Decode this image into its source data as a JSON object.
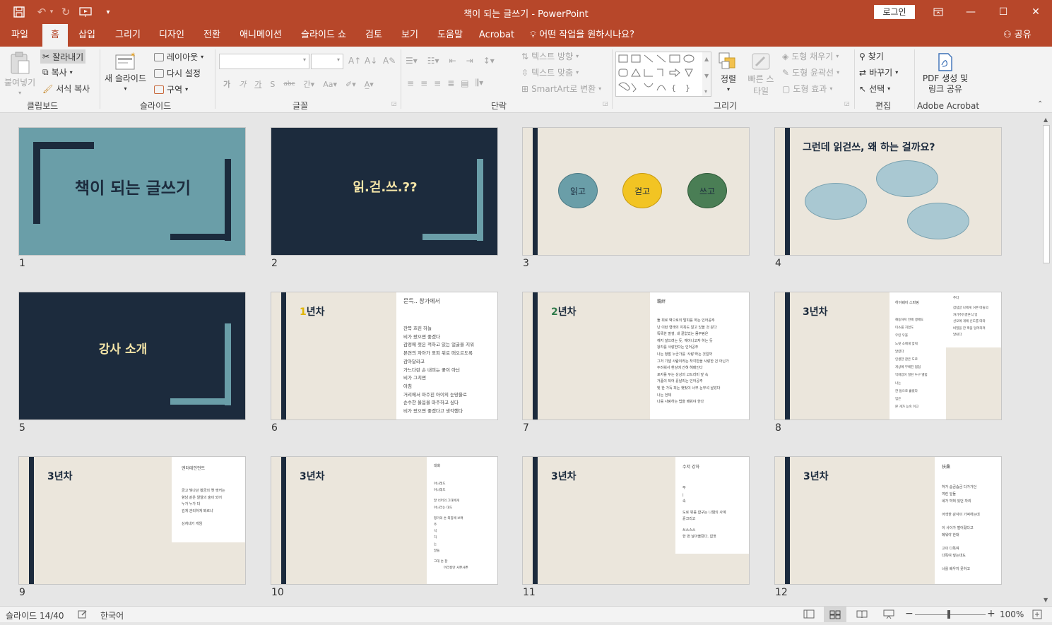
{
  "window": {
    "title": "책이 되는 글쓰기  -  PowerPoint",
    "login_label": "로그인",
    "share_label": "공유"
  },
  "tabs": [
    "파일",
    "홈",
    "삽입",
    "그리기",
    "디자인",
    "전환",
    "애니메이션",
    "슬라이드 쇼",
    "검토",
    "보기",
    "도움말",
    "Acrobat",
    "어떤 작업을 원하시나요?"
  ],
  "ribbon": {
    "clipboard": {
      "paste": "붙여넣기",
      "cut": "잘라내기",
      "copy": "복사",
      "format_painter": "서식 복사",
      "label": "클립보드"
    },
    "slides": {
      "new_slide": "새 슬라이드",
      "layout": "레이아웃",
      "reset": "다시 설정",
      "section": "구역",
      "label": "슬라이드"
    },
    "font": {
      "label": "글꼴",
      "small_a": "가",
      "case": "Aa",
      "spacing": "간"
    },
    "paragraph": {
      "text_direction": "텍스트 방향",
      "align_text": "텍스트 맞춤",
      "smartart": "SmartArt로 변환",
      "label": "단락"
    },
    "drawing": {
      "arrange": "정렬",
      "quick_styles": "빠른 스타일",
      "shape_fill": "도형 채우기",
      "shape_outline": "도형 윤곽선",
      "shape_effects": "도형 효과",
      "label": "그리기"
    },
    "editing": {
      "find": "찾기",
      "replace": "바꾸기",
      "select": "선택",
      "label": "편집"
    },
    "acrobat": {
      "pdf": "PDF 생성 및 링크 공유",
      "label": "Adobe Acrobat"
    }
  },
  "slides": [
    {
      "num": "1",
      "title": "책이 되는 글쓰기"
    },
    {
      "num": "2",
      "title": "읽.걷.쓰.??"
    },
    {
      "num": "3",
      "bubbles": [
        "읽고",
        "걷고",
        "쓰고"
      ]
    },
    {
      "num": "4",
      "title": "그런데 읽걷쓰, 왜 하는 걸까요?"
    },
    {
      "num": "5",
      "title": "강사 소개"
    },
    {
      "num": "6",
      "title_prefix": "1",
      "title_suffix": "년차",
      "side_title": "문득.. 창가에서",
      "lines": [
        "잔뜩 흐린 하늘",
        "비가 왔으면 좋겠다",
        "감정에 젖은 적하고 있는 얼굴을 지워",
        "본연의 자아가 표피 위로 떠오르도록",
        "감아달라고",
        "가느다란 손 내미는 꽃이 아닌",
        "비가 그치면",
        "아침",
        "거리에서 마주친 아이의 눈망울로",
        "순수한 울음을 마주하고 싶다",
        "비가 왔으면 좋겠다고 생각했다"
      ]
    },
    {
      "num": "7",
      "title_prefix": "2",
      "title_suffix": "년차",
      "side_title": "羈絆",
      "lines": [
        "둘 위로 벽으로의 탈피를 하는 인어공주",
        "난 이런 형태의 지옥도 알고 있을 것 같다",
        "똑똑한 말썽, 내 끝없었는 몸부림은",
        "깨지 않으려는 듯, 깨어나고자 하는 듯",
        "왕자를 사랑한다는 인어공주",
        "나는 정말 누군가를 '사랑'하는 것일까",
        "그저 기댈 사람이라는 착각만을 사랑한 건 아닌가",
        "두려워서 환상에 간혀 헤매인다",
        "포자를 두는 상상의 고드러미 앞 속",
        "거품이 되어 흩날리는 인어공주",
        "빛 한 가득 피는 햇빛이 너무 눈부셔 날았다",
        "나는 언제",
        "나를 사랑하는 법을 배워야 한다"
      ]
    },
    {
      "num": "8",
      "title": "3년차",
      "side_title": "하이웨이 스파링",
      "lines": [
        "해동하지 전에 생애도",
        "미소를 지었도",
        "우린 우울",
        "느릿 소에게 맞춰",
        "달렸다",
        "인생한 잡은 도로",
        "게상에 무에진 협업",
        "막혀있어 절된 누구 앨범",
        "나는",
        "한 틈으로 흘렀다",
        "멈은",
        "본 게가 능숙 이고"
      ],
      "side2_title": "추다",
      "lines2": [
        "잠념글 나에게 거른 따들의",
        "자기주유결혼식 빙",
        "선모에 게에 신도를 따라",
        "비밀을 한 짝을 달려리려",
        "달린다"
      ]
    },
    {
      "num": "9",
      "title": "3년차",
      "side_title": "엔터테인먼트",
      "lines": [
        "금고 빛나던 황금의 옛 엣커는",
        "향남 같은 알알의 술이 되어",
        "누가 누가 더",
        "깊게 관리하게 쫘르냐",
        "상처내기 게임"
      ]
    },
    {
      "num": "10",
      "title": "3년차",
      "side_title": "대화",
      "lines": [
        "아니래도",
        "아니래도",
        "말 너머의 그대에게",
        "아니라는 대도",
        "평거의 손 외침에 보여",
        "주",
        "석",
        "하",
        "는",
        "말들",
        "그대 손 잡",
        "머리칼만 사쁜사쁜"
      ]
    },
    {
      "num": "11",
      "title": "3년차",
      "side_title": "수저 강하",
      "lines": [
        "무",
        "|",
        "속",
        "도로 위를 함구는 나염의 사계",
        "흩크리고",
        "쓰스스스",
        "한 번 날아올랐다, 힘껏"
      ]
    },
    {
      "num": "12",
      "title": "3년차",
      "side_title": "扶桑",
      "lines": [
        "허가 솜금솜금 다가가던",
        "여린 잎들",
        "네가 박혀 있던 자리",
        "어색한 감각이 기억하는데",
        "이 사이가 벌어졌다고",
        "메워야 한대",
        "고이 다독여",
        "다독여 덮는대도",
        "너를 배우지 못하고"
      ]
    }
  ],
  "status": {
    "slide_info": "슬라이드 14/40",
    "language": "한국어",
    "zoom": "100%"
  },
  "colors": {
    "accent": "#b7472a",
    "teal": "#6a9ea8",
    "navy": "#1c2b3d",
    "beige": "#ebe6dc"
  }
}
